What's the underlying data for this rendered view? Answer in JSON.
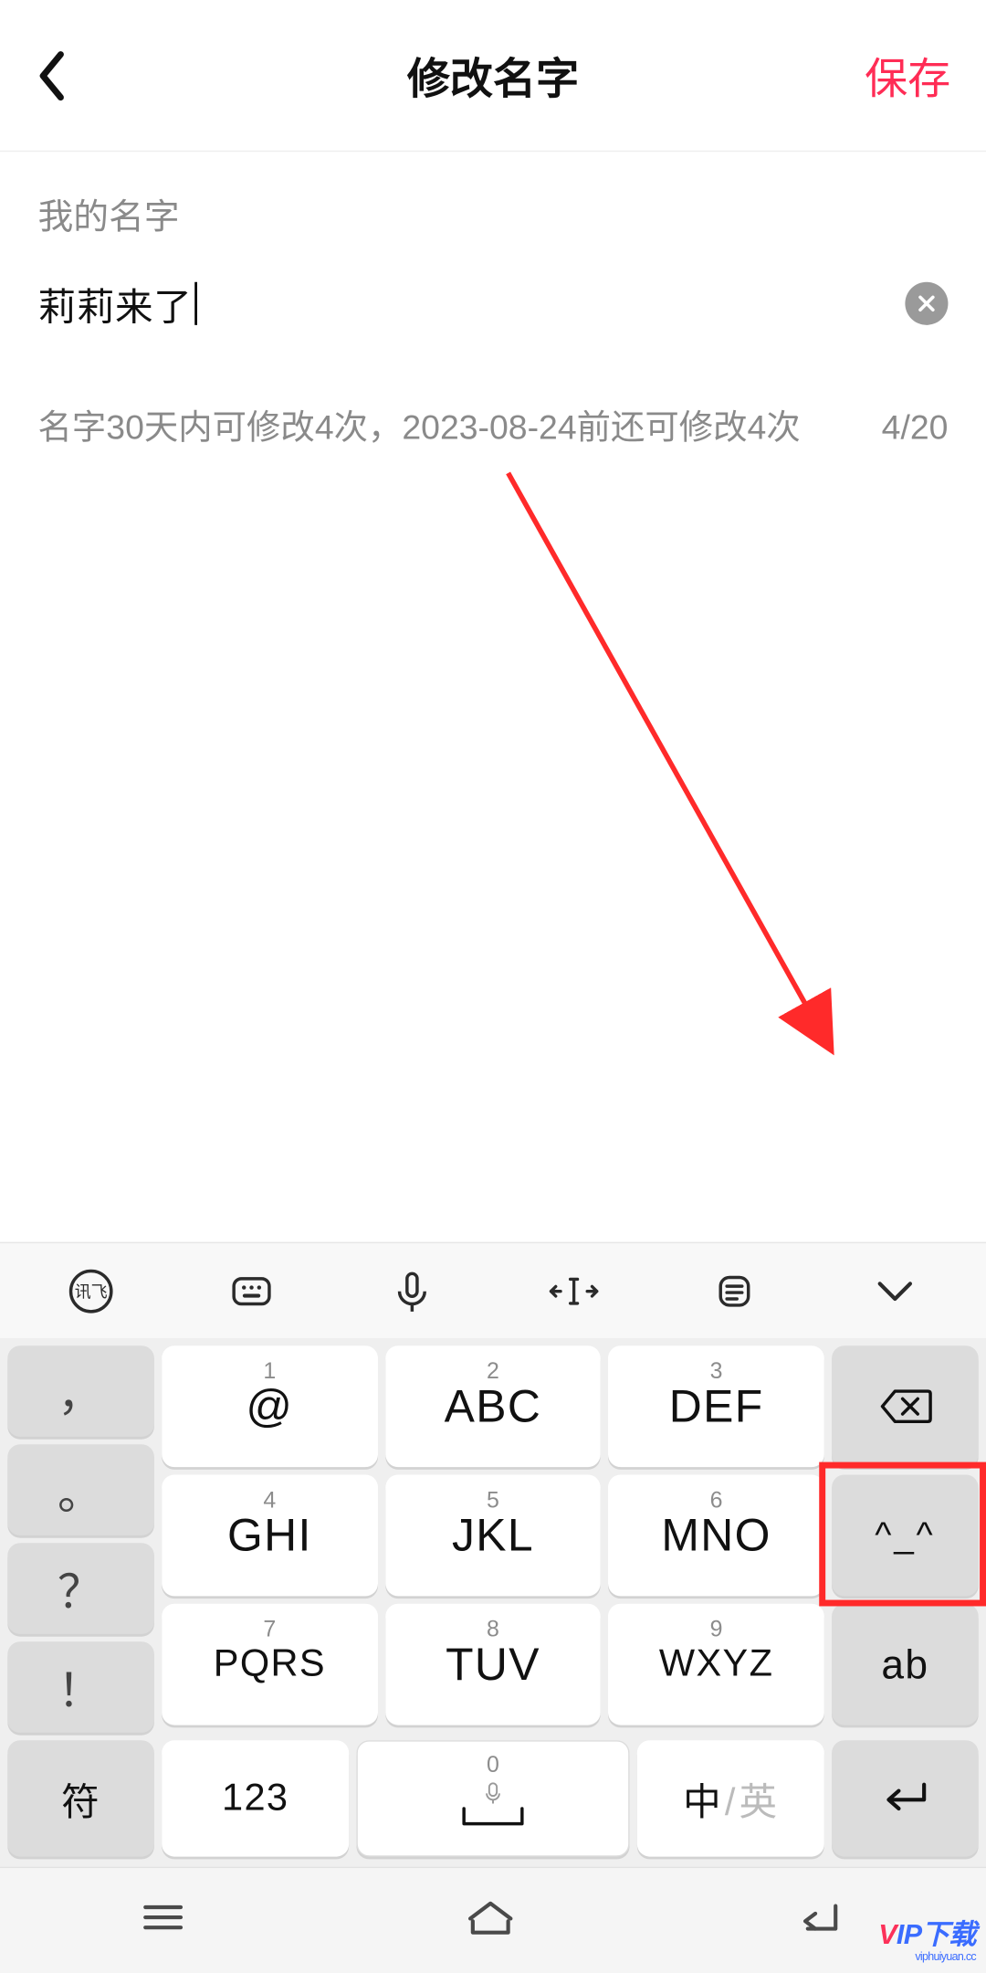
{
  "header": {
    "title": "修改名字",
    "save": "保存"
  },
  "form": {
    "label": "我的名字",
    "value": "莉莉来了",
    "hint": "名字30天内可修改4次，2023-08-24前还可修改4次",
    "counter": "4/20"
  },
  "toolbar": {
    "xunfei": "讯飞"
  },
  "keys": {
    "punct_comma": "，",
    "punct_period": "。",
    "punct_q": "？",
    "punct_excl": "！",
    "n1": "1",
    "k1": "@",
    "n2": "2",
    "k2": "ABC",
    "n3": "3",
    "k3": "DEF",
    "n4": "4",
    "k4": "GHI",
    "n5": "5",
    "k5": "JKL",
    "n6": "6",
    "k6": "MNO",
    "n7": "7",
    "k7": "PQRS",
    "n8": "8",
    "k8": "TUV",
    "n9": "9",
    "k9": "WXYZ",
    "emoticon": "^_^",
    "ab": "ab",
    "sym": "符",
    "num123": "123",
    "space_n": "0",
    "lang_zh": "中",
    "lang_en": "英"
  },
  "watermark": {
    "main": "VIP下载",
    "sub": "viphuiyuan.cc"
  }
}
